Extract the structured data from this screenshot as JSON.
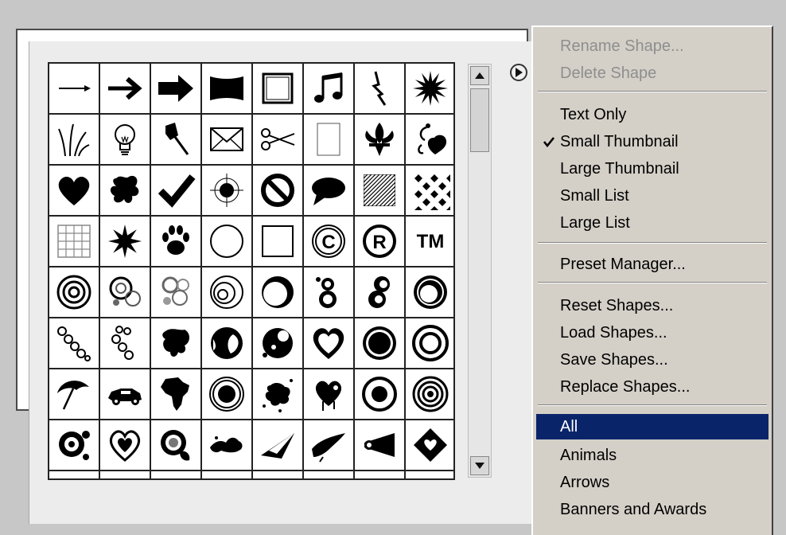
{
  "menu": {
    "items": [
      {
        "label": "Rename Shape...",
        "disabled": true
      },
      {
        "label": "Delete Shape",
        "disabled": true
      },
      {
        "label": "Text Only"
      },
      {
        "label": "Small Thumbnail",
        "checked": true
      },
      {
        "label": "Large Thumbnail"
      },
      {
        "label": "Small List"
      },
      {
        "label": "Large List"
      },
      {
        "label": "Preset Manager..."
      },
      {
        "label": "Reset Shapes..."
      },
      {
        "label": "Load Shapes..."
      },
      {
        "label": "Save Shapes..."
      },
      {
        "label": "Replace Shapes..."
      },
      {
        "label": "All",
        "selected": true
      },
      {
        "label": "Animals"
      },
      {
        "label": "Arrows"
      },
      {
        "label": "Banners and Awards"
      }
    ]
  },
  "shapes": {
    "icons": [
      "arrow-thin-icon",
      "arrow-bold-icon",
      "arrow-heavy-icon",
      "banner-icon",
      "frame-icon",
      "music-notes-icon",
      "lightning-icon",
      "starburst-icon",
      "grass-icon",
      "lightbulb-icon",
      "pushpin-icon",
      "envelope-icon",
      "scissors-icon",
      "blank-page-icon",
      "fleur-de-lis-icon",
      "ornament-heart-icon",
      "heart-icon",
      "splat-icon",
      "checkmark-icon",
      "crosshair-icon",
      "no-sign-icon",
      "speech-bubble-icon",
      "hatched-square-icon",
      "diamond-pattern-icon",
      "grid-icon",
      "sunburst-icon",
      "paw-print-icon",
      "circle-outline-icon",
      "square-outline-icon",
      "copyright-icon",
      "registered-icon",
      "trademark-icon",
      "concentric-circles-icon",
      "grunge-circles-icon",
      "grunge-rings-icon",
      "spiral-circles-icon",
      "crescent-ring-icon",
      "bubbles-icon",
      "figure-eight-icon",
      "double-ring-icon",
      "dotted-circles-icon",
      "chain-circles-icon",
      "ink-blob-icon",
      "pac-circle-icon",
      "splash-circle-icon",
      "double-heart-icon",
      "thick-ring-icon",
      "double-circle-icon",
      "umbrella-icon",
      "car-icon",
      "africa-icon",
      "target-rings-icon",
      "splatter-icon",
      "drip-heart-icon",
      "dot-ring-icon",
      "bullseye-icon",
      "grunge-gear-icon",
      "grunge-heart-icon",
      "grunge-pattern-icon",
      "splash-shape-icon",
      "paper-plane-icon",
      "brush-stroke-icon",
      "horn-icon",
      "diamond-heart-icon"
    ],
    "extra_row": [
      "partial-shape-icon",
      "partial-shape-icon",
      "partial-shape-icon",
      "partial-shape-icon",
      "partial-shape-icon",
      "partial-shape-icon",
      "partial-shape-icon",
      "partial-shape-icon"
    ]
  },
  "glyphs": {
    "trademark": "TM",
    "registered": "R",
    "copyright": "C"
  }
}
